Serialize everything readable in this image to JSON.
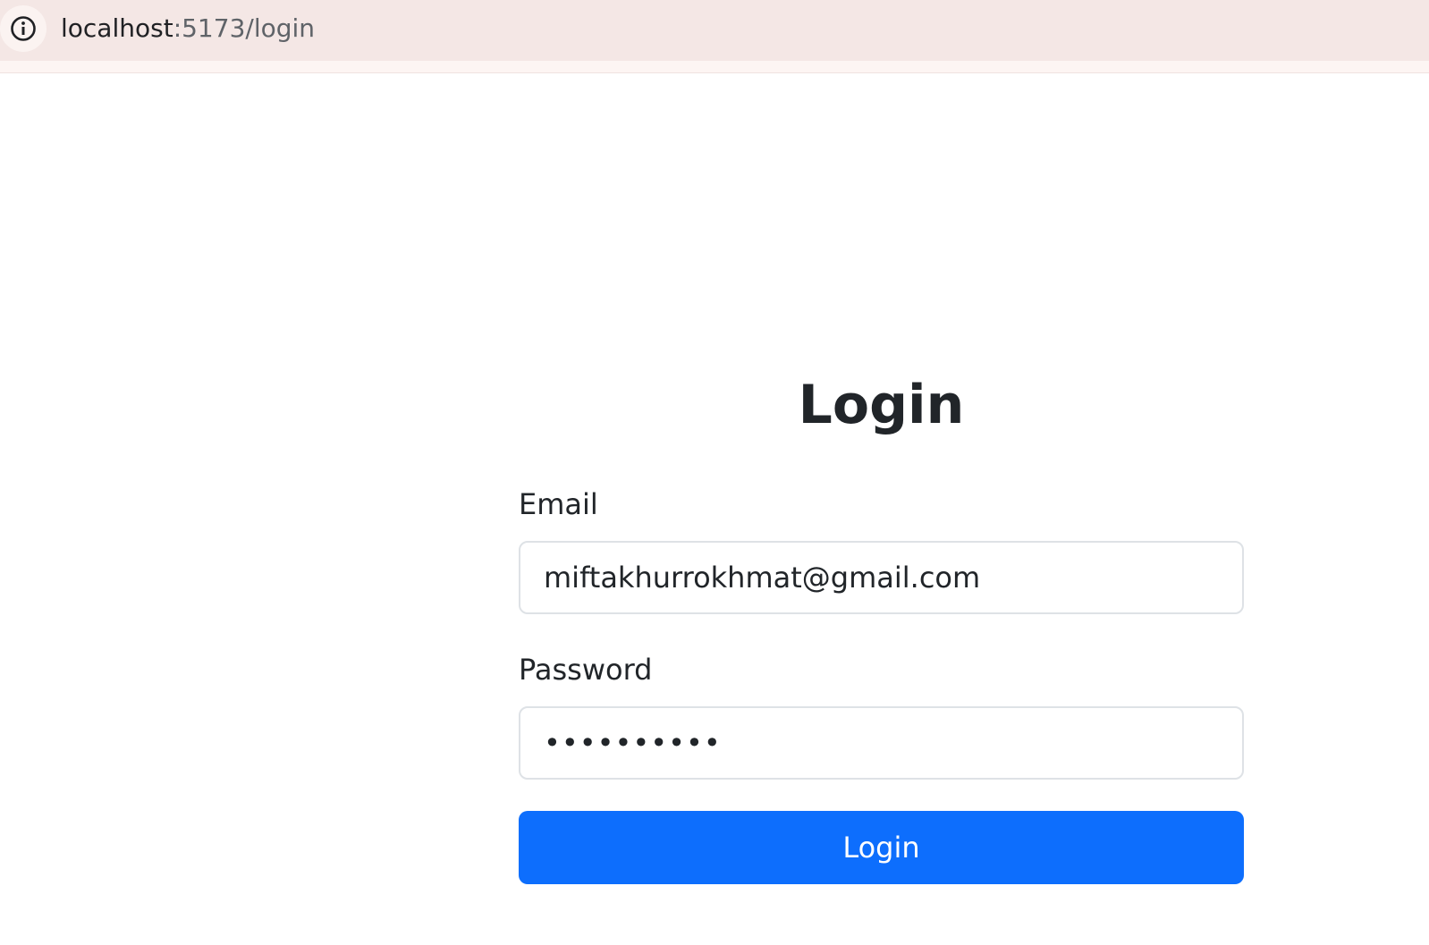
{
  "browser": {
    "url_host": "localhost",
    "url_path": ":5173/login",
    "site_info_icon": "info-icon"
  },
  "form": {
    "title": "Login",
    "email_label": "Email",
    "email_value": "miftakhurrokhmat@gmail.com",
    "password_label": "Password",
    "password_value": "••••••••••",
    "submit_label": "Login"
  },
  "colors": {
    "browser_bar": "#f4e7e5",
    "primary_button": "#0d6efd",
    "input_border": "#dee2e6",
    "text": "#212529"
  }
}
